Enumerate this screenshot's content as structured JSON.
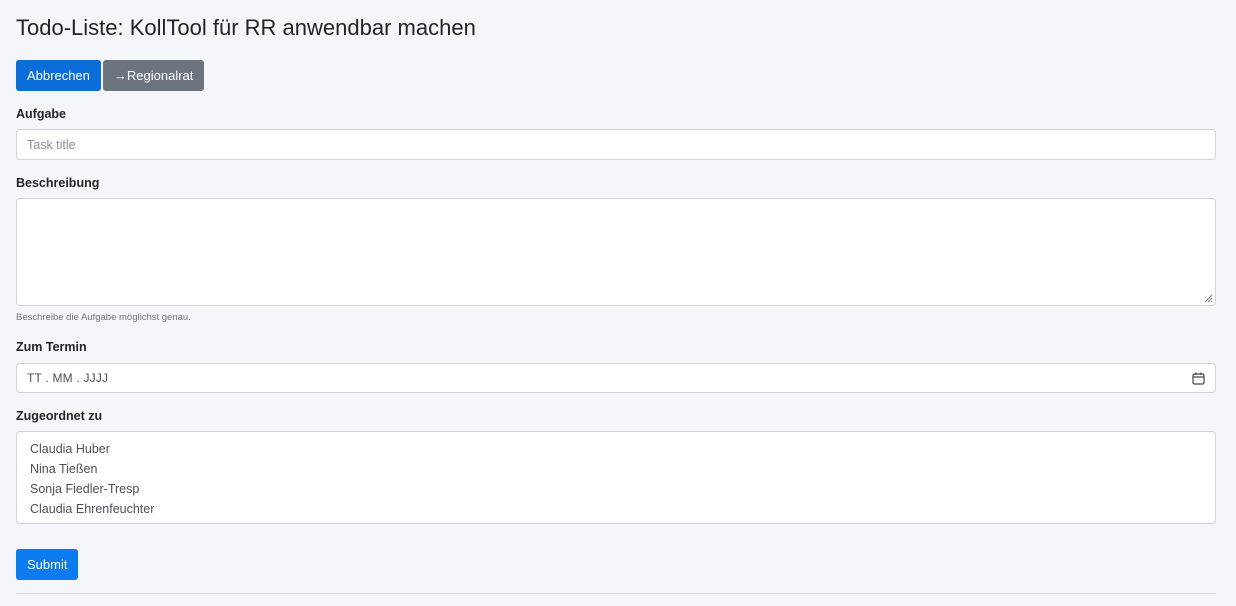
{
  "page": {
    "title": "Todo-Liste: KollTool für RR anwendbar machen"
  },
  "actions": {
    "cancel_label": "Abbrechen",
    "regionalrat_label": "→Regionalrat"
  },
  "form": {
    "task": {
      "label": "Aufgabe",
      "placeholder": "Task title",
      "value": ""
    },
    "description": {
      "label": "Beschreibung",
      "value": "",
      "help": "Beschreibe die Aufgabe möglichst genau."
    },
    "due": {
      "label": "Zum Termin",
      "placeholder": "TT . MM . JJJJ",
      "icon": "calendar-icon"
    },
    "assignees": {
      "label": "Zugeordnet zu",
      "options": [
        "Claudia Huber",
        "Nina Tießen",
        "Sonja Fiedler-Tresp",
        "Claudia Ehrenfeuchter"
      ]
    },
    "submit_label": "Submit"
  },
  "colors": {
    "background": "#f4f6f9",
    "primary": "#0b6ed8",
    "secondary": "#6c757d",
    "submit": "#0d7bf0",
    "border": "#ced4da"
  }
}
